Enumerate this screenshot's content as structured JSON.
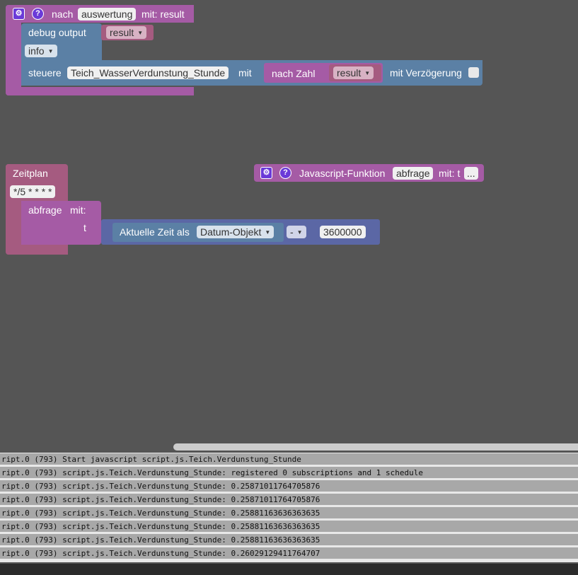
{
  "colors": {
    "workspace": "#555555",
    "procedure": "#a55ba5",
    "io": "#5b80a5",
    "math": "#5b67a5",
    "variable": "#a55b80",
    "field": "#f0f0f0"
  },
  "block_group_1": {
    "header": {
      "settings_icon": "gear-icon",
      "help_icon": "?",
      "label_before": "nach",
      "function_name": "auswertung",
      "label_after": "mit: result"
    },
    "debug": {
      "label": "debug output",
      "value": "result",
      "level": "info"
    },
    "control": {
      "label": "steuere",
      "target": "Teich_WasserVerdunstung_Stunde",
      "with_label": "mit",
      "convert_label": "nach Zahl",
      "convert_value": "result",
      "delay_label": "mit Verzögerung"
    }
  },
  "block_group_2": {
    "schedule": {
      "label": "Zeitplan",
      "cron": "*/5 * * * *"
    },
    "call": {
      "function_name": "abfrage",
      "with_label": "mit:",
      "param": "t"
    },
    "time": {
      "label": "Aktuelle Zeit als",
      "format": "Datum-Objekt",
      "operator": "-",
      "number": "3600000"
    }
  },
  "block_group_3": {
    "settings_icon": "gear-icon",
    "help_icon": "?",
    "label": "Javascript-Funktion",
    "function_name": "abfrage",
    "label_after": "mit: t",
    "more": "..."
  },
  "log": [
    "ript.0 (793) Start javascript script.js.Teich.Verdunstung_Stunde",
    "ript.0 (793) script.js.Teich.Verdunstung_Stunde: registered 0 subscriptions and 1 schedule",
    "ript.0 (793) script.js.Teich.Verdunstung_Stunde: 0.25871011764705876",
    "ript.0 (793) script.js.Teich.Verdunstung_Stunde: 0.25871011764705876",
    "ript.0 (793) script.js.Teich.Verdunstung_Stunde: 0.25881163636363635",
    "ript.0 (793) script.js.Teich.Verdunstung_Stunde: 0.25881163636363635",
    "ript.0 (793) script.js.Teich.Verdunstung_Stunde: 0.25881163636363635",
    "ript.0 (793) script.js.Teich.Verdunstung_Stunde: 0.26029129411764707"
  ]
}
